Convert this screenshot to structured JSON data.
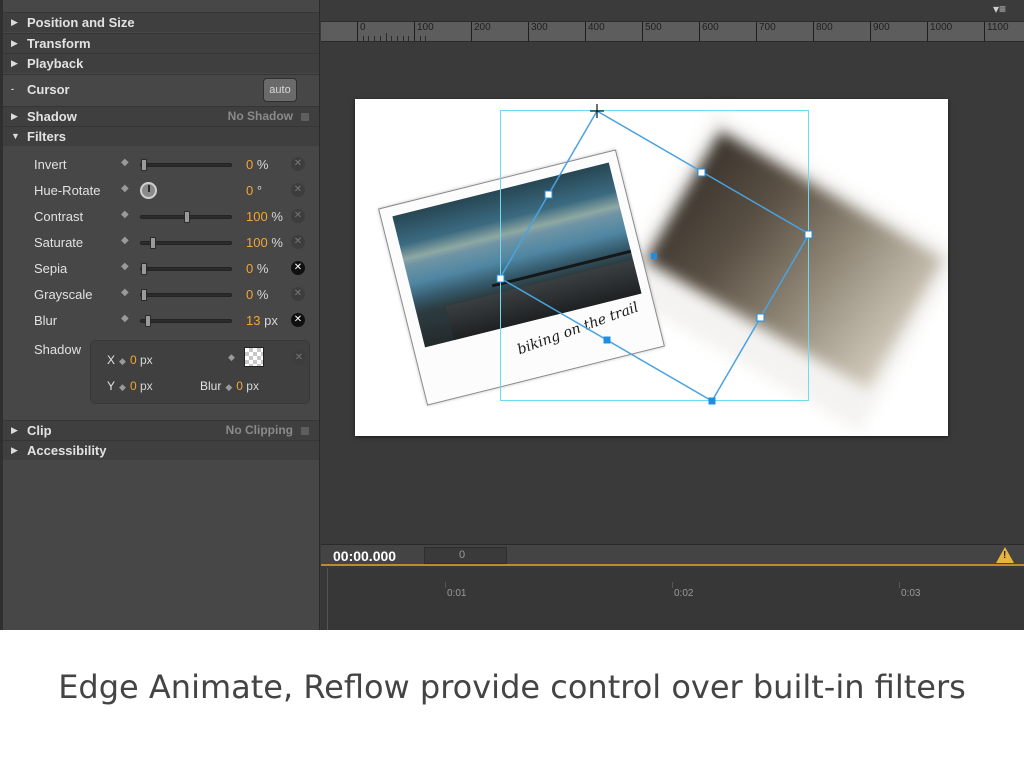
{
  "panel": {
    "sections_top": [
      {
        "name": "section-position-size",
        "label": "Position and Size"
      },
      {
        "name": "section-transform",
        "label": "Transform"
      },
      {
        "name": "section-playback",
        "label": "Playback"
      }
    ],
    "cursor": {
      "label": "Cursor",
      "button": "auto"
    },
    "shadow": {
      "label": "Shadow",
      "value": "No Shadow"
    },
    "filters": {
      "label": "Filters",
      "rows": [
        {
          "label": "Invert",
          "value": "0",
          "unit": "%",
          "fraction": 0.0,
          "active": false,
          "control": "slider"
        },
        {
          "label": "Hue-Rotate",
          "value": "0",
          "unit": "°",
          "fraction": 0.0,
          "active": false,
          "control": "dial"
        },
        {
          "label": "Contrast",
          "value": "100",
          "unit": "%",
          "fraction": 0.5,
          "active": false,
          "control": "slider"
        },
        {
          "label": "Saturate",
          "value": "100",
          "unit": "%",
          "fraction": 0.1,
          "active": false,
          "control": "slider"
        },
        {
          "label": "Sepia",
          "value": "0",
          "unit": "%",
          "fraction": 0.0,
          "active": true,
          "control": "slider"
        },
        {
          "label": "Grayscale",
          "value": "0",
          "unit": "%",
          "fraction": 0.0,
          "active": false,
          "control": "slider"
        },
        {
          "label": "Blur",
          "value": "13",
          "unit": "px",
          "fraction": 0.05,
          "active": true,
          "control": "slider"
        }
      ],
      "shadow": {
        "label": "Shadow",
        "x_label": "X",
        "x_value": "0",
        "x_unit": "px",
        "y_label": "Y",
        "y_value": "0",
        "y_unit": "px",
        "blur_label": "Blur",
        "blur_value": "0",
        "blur_unit": "px"
      }
    },
    "clip": {
      "label": "Clip",
      "value": "No Clipping"
    },
    "accessibility": {
      "label": "Accessibility"
    }
  },
  "ruler": {
    "ticks": [
      "0",
      "100",
      "200",
      "300",
      "400",
      "500",
      "600",
      "700",
      "800",
      "900",
      "1000",
      "1100"
    ]
  },
  "stage": {
    "caption_text": "biking on the trail"
  },
  "timeline": {
    "timecode": "00:00.000",
    "frame": "0",
    "marks": [
      "0:01",
      "0:02",
      "0:03"
    ]
  },
  "caption": "Edge Animate, Reflow provide control over built-in filters",
  "colors": {
    "accent_value": "#f3a534",
    "selection": "#6ddcf3",
    "warning": "#e8b53b"
  }
}
